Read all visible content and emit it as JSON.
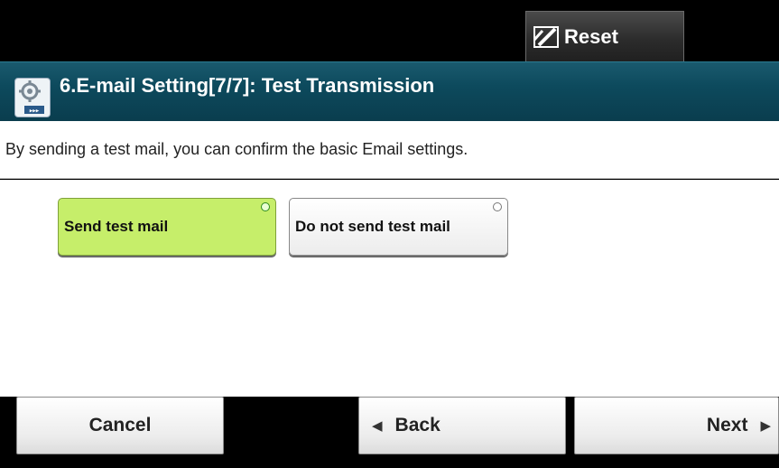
{
  "header": {
    "reset_label": "Reset"
  },
  "title": {
    "text": "6.E-mail Setting[7/7]: Test Transmission"
  },
  "description": "By sending a test mail, you can confirm the basic Email settings.",
  "options": [
    {
      "label": "Send test mail",
      "selected": true
    },
    {
      "label": "Do not send test mail",
      "selected": false
    }
  ],
  "footer": {
    "cancel_label": "Cancel",
    "back_label": "Back",
    "next_label": "Next"
  },
  "colors": {
    "title_bar": "#0d4a5d",
    "selected_option": "#c6ee6a"
  }
}
